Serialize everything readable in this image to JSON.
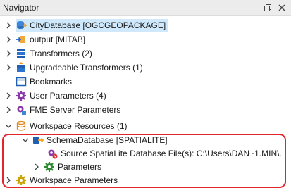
{
  "panel": {
    "title": "Navigator",
    "buttons": {
      "restore": "restore-icon",
      "close": "close-icon"
    }
  },
  "tree": {
    "items": [
      {
        "label": "CityDatabase [OGCGEOPACKAGE]",
        "icon": "reader-icon",
        "expand": "collapsed",
        "selected": true
      },
      {
        "label": "output [MITAB]",
        "icon": "writer-icon",
        "expand": "collapsed"
      },
      {
        "label": "Transformers (2)",
        "icon": "transformers-icon",
        "expand": "collapsed"
      },
      {
        "label": "Upgradeable Transformers (1)",
        "icon": "upgrade-icon",
        "expand": "collapsed"
      },
      {
        "label": "Bookmarks",
        "icon": "bookmark-icon",
        "expand": "none"
      },
      {
        "label": "User Parameters (4)",
        "icon": "gear-icon",
        "expand": "collapsed"
      },
      {
        "label": "FME Server Parameters",
        "icon": "server-params-icon",
        "expand": "collapsed"
      },
      {
        "label": "Workspace Resources (1)",
        "icon": "database-icon",
        "expand": "expanded"
      },
      {
        "label": "SchemaDatabase [SPATIALITE]",
        "icon": "schema-reader-icon",
        "expand": "expanded"
      },
      {
        "label": "Source SpatiaLite Database File(s): C:\\Users\\DAN~1.MIN\\...",
        "icon": "source-param-icon",
        "expand": "none"
      },
      {
        "label": "Parameters",
        "icon": "gear-icon",
        "expand": "collapsed"
      },
      {
        "label": "Workspace Parameters",
        "icon": "gear-icon",
        "expand": "collapsed"
      }
    ]
  },
  "colors": {
    "selection": "#cfe8fb",
    "highlight_border": "#e3242b",
    "titlebar": "#ececec"
  }
}
